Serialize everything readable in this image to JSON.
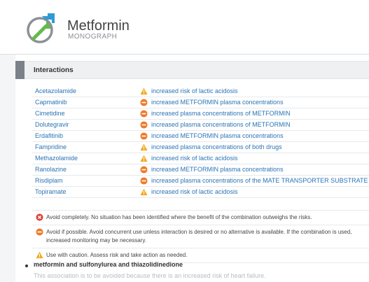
{
  "monograph": {
    "title": "Metformin",
    "subtitle": "MONOGRAPH"
  },
  "section": {
    "title": "Interactions"
  },
  "interactions": [
    {
      "drug": "Acetazolamide",
      "severity": "caution",
      "effect": "increased risk of lactic acidosis"
    },
    {
      "drug": "Capmatinib",
      "severity": "avoid",
      "effect": "increased METFORMIN plasma concentrations"
    },
    {
      "drug": "Cimetidine",
      "severity": "avoid",
      "effect": "increased plasma concentrations of METFORMIN"
    },
    {
      "drug": "Dolutegravir",
      "severity": "avoid",
      "effect": "increased plasma concentrations of METFORMIN"
    },
    {
      "drug": "Erdafitinib",
      "severity": "avoid",
      "effect": "increased METFORMIN plasma concentrations"
    },
    {
      "drug": "Fampridine",
      "severity": "caution",
      "effect": "increased plasma concentrations of both drugs"
    },
    {
      "drug": "Methazolamide",
      "severity": "caution",
      "effect": "increased risk of lactic acidosis"
    },
    {
      "drug": "Ranolazine",
      "severity": "avoid",
      "effect": "increased METFORMIN plasma concentrations"
    },
    {
      "drug": "Risdiplam",
      "severity": "avoid",
      "effect": "increased plasma concentrations of the MATE TRANSPORTER SUBSTRATE"
    },
    {
      "drug": "Topiramate",
      "severity": "caution",
      "effect": "increased risk of lactic acidosis"
    }
  ],
  "legend": [
    {
      "severity": "contraindicated",
      "text": "Avoid completely. No situation has been identified where the benefit of the combination outweighs the risks."
    },
    {
      "severity": "avoid",
      "text": "Avoid if possible. Avoid concurrent use unless interaction is desired or no alternative is available. If the combination is used, increased monitoring may be necessary."
    },
    {
      "severity": "caution",
      "text": "Use with caution. Assess risk and take action as needed."
    }
  ],
  "note": {
    "title": "metformin and sulfonylurea and thiazolidinedione",
    "text": "This association is to be avoided because there is an increased risk of heart failure."
  },
  "colors": {
    "link": "#2a74b5",
    "caution": "#f2a81d",
    "avoid": "#f07a2a",
    "contraindicated": "#d9443b",
    "logo_green": "#66b94d",
    "logo_blue": "#2f9bd6"
  },
  "icons": {
    "caution": "warning-triangle-icon",
    "avoid": "minus-circle-icon",
    "contraindicated": "x-circle-icon",
    "logo": "arrows-logo-icon"
  }
}
